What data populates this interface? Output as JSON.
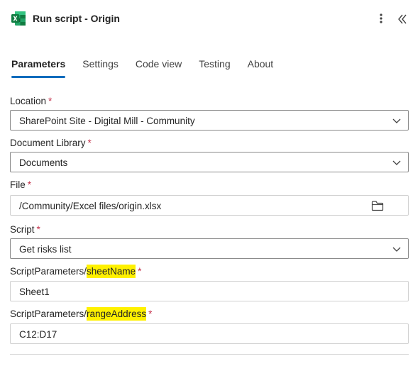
{
  "header": {
    "title": "Run script - Origin",
    "app_icon": "excel-icon",
    "more_icon": "more-vertical-icon",
    "collapse_icon": "collapse-double-chevron-icon"
  },
  "tabs": [
    {
      "label": "Parameters",
      "active": true
    },
    {
      "label": "Settings",
      "active": false
    },
    {
      "label": "Code view",
      "active": false
    },
    {
      "label": "Testing",
      "active": false
    },
    {
      "label": "About",
      "active": false
    }
  ],
  "fields": {
    "location": {
      "label": "Location",
      "required_mark": "*",
      "value": "SharePoint Site - Digital Mill - Community"
    },
    "document_library": {
      "label": "Document Library",
      "required_mark": "*",
      "value": "Documents"
    },
    "file": {
      "label": "File",
      "required_mark": "*",
      "value": "/Community/Excel files/origin.xlsx"
    },
    "script": {
      "label": "Script",
      "required_mark": "*",
      "value": "Get risks list"
    },
    "sheet_name": {
      "label_prefix": "ScriptParameters/",
      "label_highlight": "sheetName",
      "required_mark": "*",
      "value": "Sheet1"
    },
    "range_address": {
      "label_prefix": "ScriptParameters/",
      "label_highlight": "rangeAddress",
      "required_mark": "*",
      "value": "C12:D17"
    }
  },
  "colors": {
    "accent": "#0f6cbd",
    "excel_green": "#107c41",
    "highlight": "#fff100",
    "required": "#c4314b"
  }
}
